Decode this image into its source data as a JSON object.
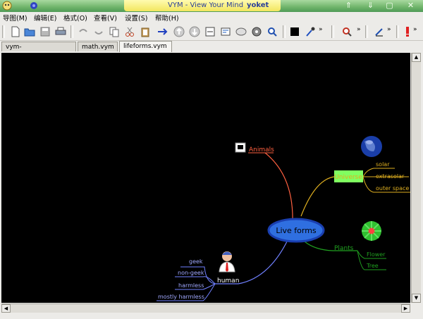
{
  "window": {
    "title": "VYM - View Your Mind",
    "user": "yoket"
  },
  "menu": [
    "导图(M)",
    "编辑(E)",
    "格式(O)",
    "查看(V)",
    "设置(S)",
    "帮助(H)"
  ],
  "tabs": [
    {
      "label": "vym-projectplan.vym",
      "active": false
    },
    {
      "label": "math.vym",
      "active": false
    },
    {
      "label": "lifeforms.vym",
      "active": true
    }
  ],
  "map": {
    "center": "Live forms",
    "branches": {
      "animals": "Animals",
      "universe": "Universe",
      "universe_children": [
        "solar",
        "extrasolar",
        "outer space"
      ],
      "plants": "Plants",
      "plants_children": [
        "Flower",
        "Tree"
      ],
      "human": "human",
      "human_children": [
        "geek",
        "non-geek",
        "harmless",
        "mostly harmless"
      ]
    }
  },
  "colors": {
    "animals": "#ff6040",
    "universe": "#e0b020",
    "universe_box": "#80ff60",
    "plants": "#20a020",
    "human": "#7080ff",
    "center_fill": "#2f6fe0"
  },
  "icons": {
    "animals": "animal-icon",
    "universe": "globe-icon",
    "plants": "flower-icon",
    "human": "person-icon"
  }
}
